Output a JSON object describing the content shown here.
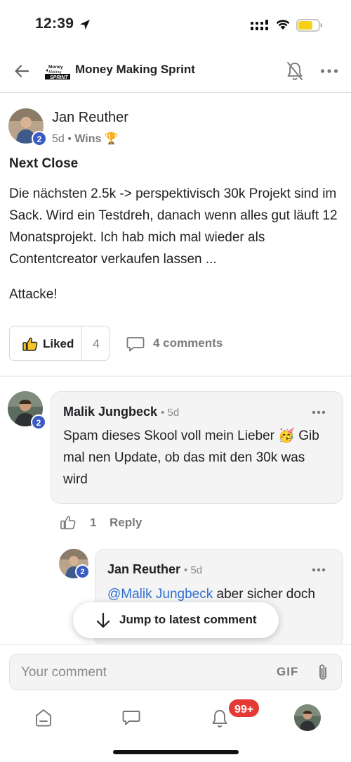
{
  "status_bar": {
    "time": "12:39"
  },
  "header": {
    "group_name": "Money Making Sprint",
    "logo_text": "Money Making SPRINT"
  },
  "post": {
    "author": "Jan Reuther",
    "level": "2",
    "time": "5d",
    "separator": "•",
    "category": "Wins",
    "category_emoji": "🏆",
    "title": "Next Close",
    "body": [
      "Die nächsten 2.5k -> perspektivisch 30k Projekt sind im Sack. Wird ein Testdreh, danach wenn alles gut läuft 12 Monatsprojekt. Ich hab mich mal wieder als Contentcreator verkaufen lassen ...",
      "Attacke!"
    ],
    "like_label": "Liked",
    "like_count": "4",
    "comments_label": "4 comments"
  },
  "comments": [
    {
      "author": "Malik Jungbeck",
      "level": "2",
      "time": "• 5d",
      "text": "Spam dieses Skool voll mein Lieber 🥳 Gib mal nen Update, ob das mit den 30k was wird",
      "like_count": "1",
      "reply_label": "Reply"
    },
    {
      "author": "Jan Reuther",
      "level": "2",
      "time": "• 5d",
      "mention": "@Malik Jungbeck",
      "text": " aber sicher doch"
    }
  ],
  "jump_pill": {
    "label": "Jump to latest comment"
  },
  "comment_input": {
    "placeholder": "Your comment",
    "gif_label": "GIF"
  },
  "bottom_nav": {
    "notification_count": "99+"
  },
  "colors": {
    "level_badge": "#3b5bc4",
    "mention": "#2f6fd1",
    "notification_badge": "#e53935",
    "battery": "#f7d117"
  }
}
